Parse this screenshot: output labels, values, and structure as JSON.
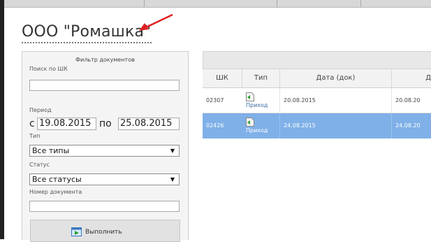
{
  "company": {
    "title": "ООО \"Ромашка\""
  },
  "filter": {
    "title": "Фильтр документов",
    "barcode_search": {
      "label": "Поиск по ШК",
      "value": ""
    },
    "period": {
      "label": "Период",
      "from_word": "с",
      "from": "19.08.2015",
      "to_word": "по",
      "to": "25.08.2015"
    },
    "type": {
      "label": "Тип",
      "selected": "Все типы"
    },
    "status": {
      "label": "Статус",
      "selected": "Все статусы"
    },
    "doc_number": {
      "label": "Номер документа",
      "value": ""
    },
    "run_button": "Выполнить"
  },
  "table": {
    "columns": [
      "ШК",
      "Тип",
      "Дата (док)",
      "Д"
    ],
    "rows": [
      {
        "sk": "02307",
        "type": "Приход",
        "date": "20.08.2015",
        "date2": "20.08.20",
        "selected": false
      },
      {
        "sk": "02426",
        "type": "Приход",
        "date": "24.08.2015",
        "date2": "24.08.20",
        "selected": true
      }
    ]
  },
  "colors": {
    "selected_row": "#7fb0e8",
    "arrow": "#e02020"
  }
}
